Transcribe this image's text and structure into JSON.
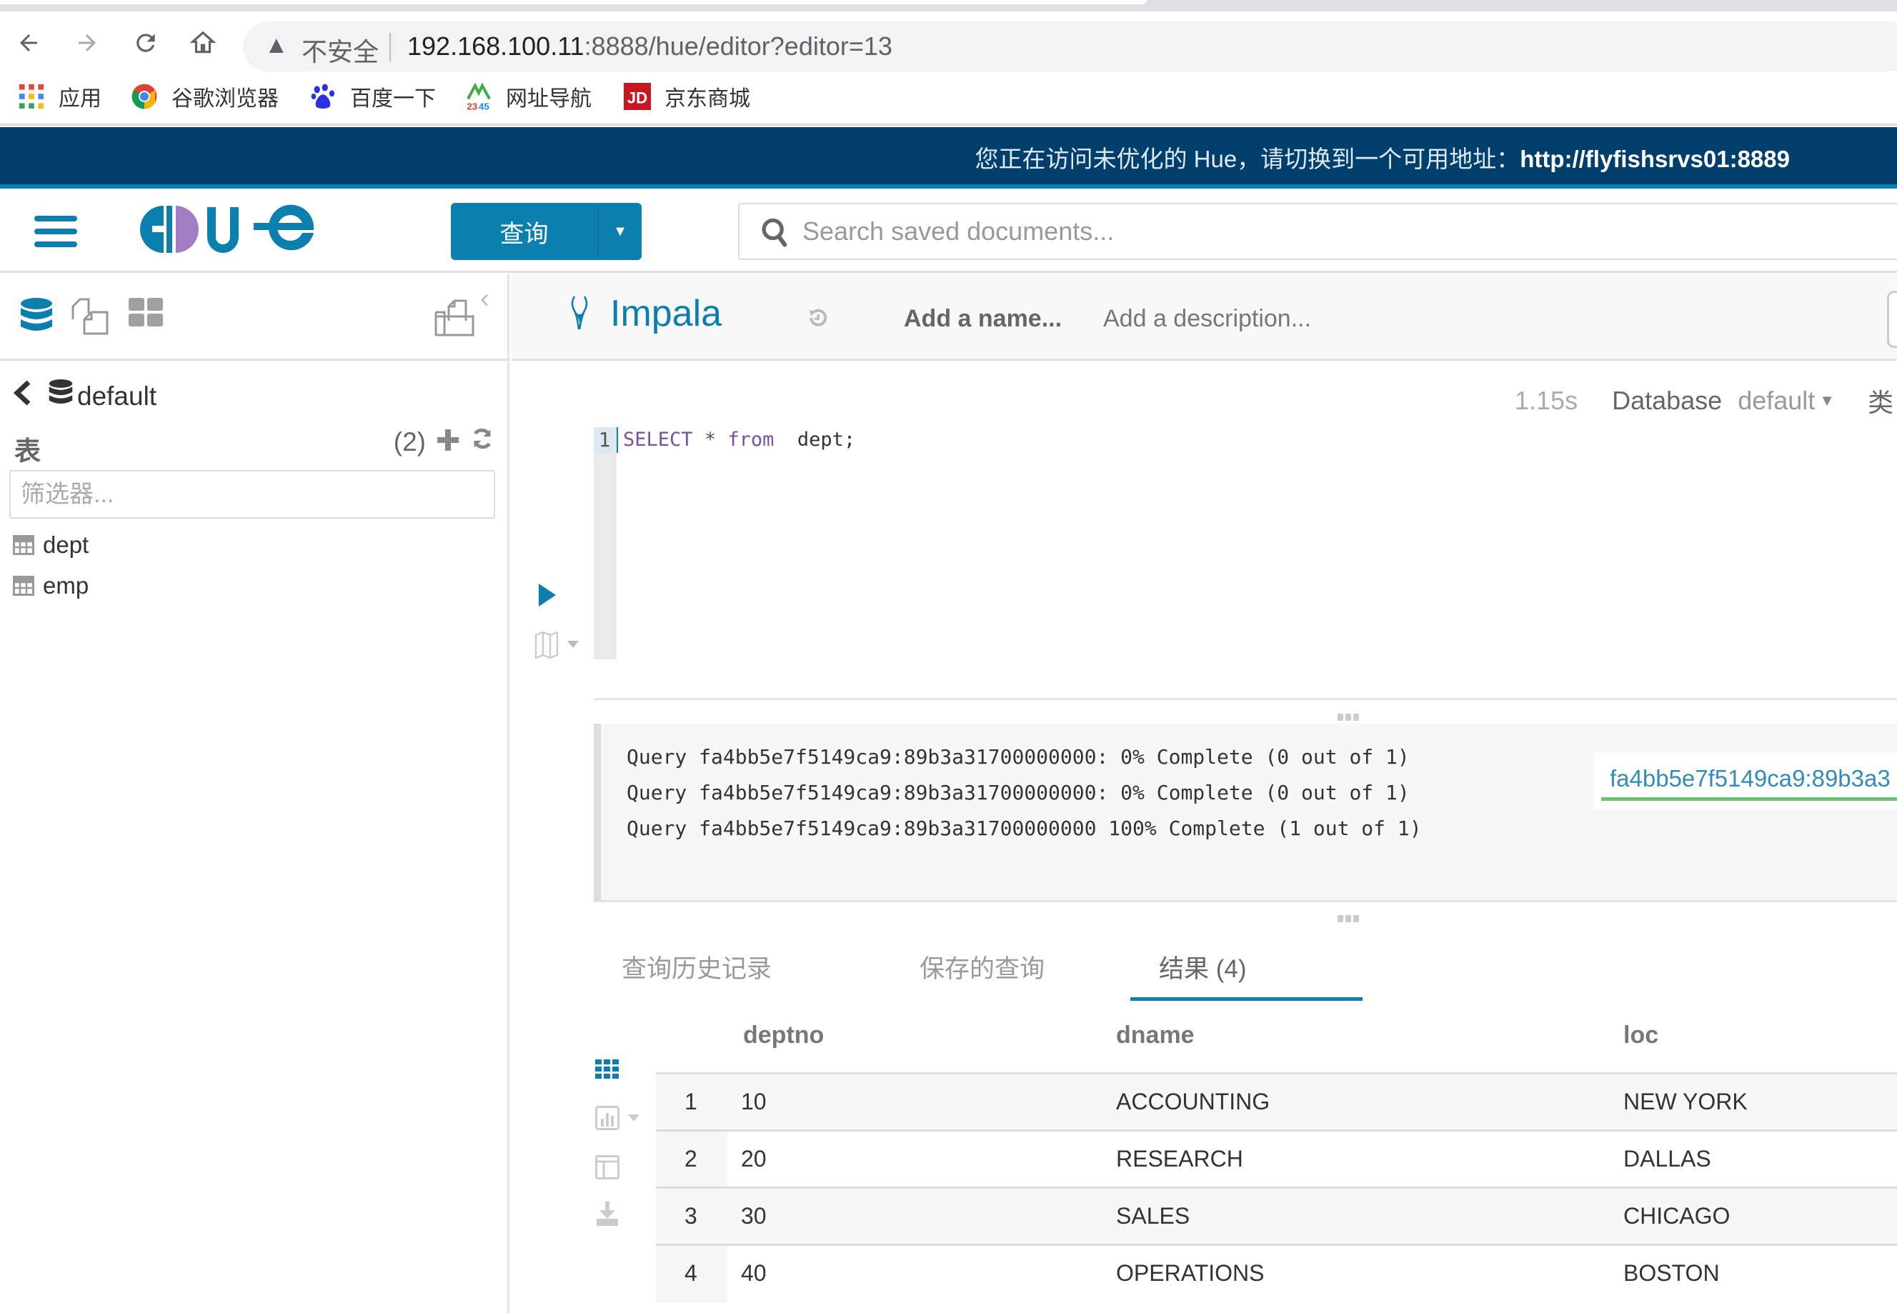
{
  "browser": {
    "url_host": "192.168.100.11",
    "url_rest": ":8888/hue/editor?editor=13",
    "security_label": "不安全",
    "icons": [
      "back-arrow-icon",
      "forward-arrow-icon",
      "reload-icon",
      "home-icon",
      "warning-icon"
    ],
    "bookmarks": [
      {
        "label": "应用",
        "icon": "apps-grid-icon"
      },
      {
        "label": "谷歌浏览器",
        "icon": "chrome-icon"
      },
      {
        "label": "百度一下",
        "icon": "baidu-paw-icon"
      },
      {
        "label": "网址导航",
        "icon": "2345-icon"
      },
      {
        "label": "京东商城",
        "icon": "jd-icon"
      }
    ]
  },
  "banner": {
    "message": "您正在访问未优化的 Hue，请切换到一个可用地址：",
    "link": "http://flyfishsrvs01:8889"
  },
  "header": {
    "logo_text": "HUE",
    "query_button_label": "查询",
    "search_placeholder": "Search saved documents..."
  },
  "sidebar": {
    "database": "default",
    "tables_title": "表",
    "tables_count": "(2)",
    "filter_placeholder": "筛选器...",
    "tables": [
      {
        "name": "dept"
      },
      {
        "name": "emp"
      }
    ]
  },
  "editor": {
    "engine": "Impala",
    "name_placeholder": "Add a name...",
    "description_placeholder": "Add a description...",
    "execution_time": "1.15s",
    "database_label": "Database",
    "database_value": "default",
    "more_label": "类",
    "line_number": "1",
    "code": {
      "keyword_select": "SELECT",
      "star": "*",
      "keyword_from": "from",
      "table": "dept;"
    }
  },
  "log": {
    "lines": [
      "Query fa4bb5e7f5149ca9:89b3a31700000000: 0% Complete (0 out of 1)",
      "Query fa4bb5e7f5149ca9:89b3a31700000000: 0% Complete (0 out of 1)",
      "Query fa4bb5e7f5149ca9:89b3a31700000000 100% Complete (1 out of 1)"
    ],
    "job_link": "fa4bb5e7f5149ca9:89b3a3",
    "job_progress_percent": 100,
    "colors": {
      "progress": "#6fbf73",
      "link": "#338bb8"
    }
  },
  "results": {
    "tabs": [
      {
        "label": "查询历史记录",
        "active": false
      },
      {
        "label": "保存的查询",
        "active": false
      },
      {
        "label": "结果 (4)",
        "active": true
      }
    ],
    "columns": [
      "deptno",
      "dname",
      "loc"
    ],
    "rows": [
      {
        "n": "1",
        "deptno": "10",
        "dname": "ACCOUNTING",
        "loc": "NEW YORK"
      },
      {
        "n": "2",
        "deptno": "20",
        "dname": "RESEARCH",
        "loc": "DALLAS"
      },
      {
        "n": "3",
        "deptno": "30",
        "dname": "SALES",
        "loc": "CHICAGO"
      },
      {
        "n": "4",
        "deptno": "40",
        "dname": "OPERATIONS",
        "loc": "BOSTON"
      }
    ]
  },
  "theme": {
    "accent": "#0b7fad",
    "banner_bg": "#003e6b",
    "keyword": "#7b4fa6"
  }
}
